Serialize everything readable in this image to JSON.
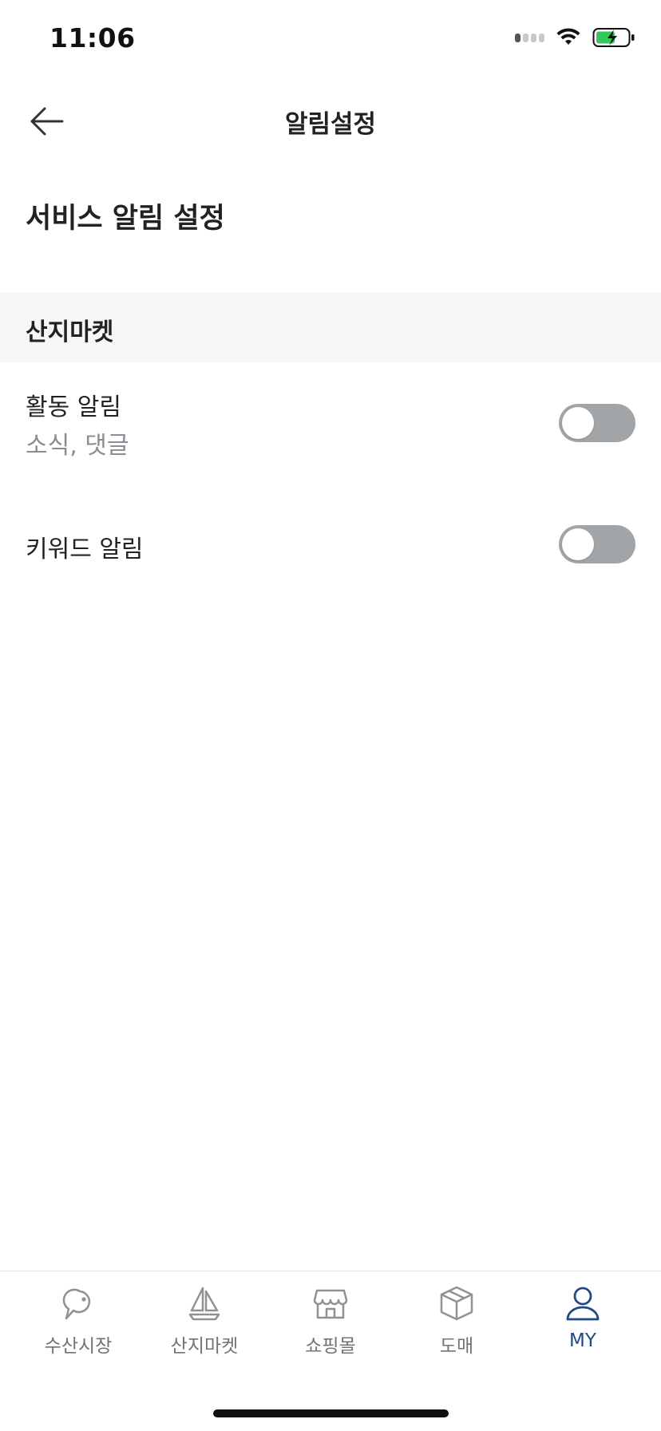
{
  "status": {
    "time": "11:06"
  },
  "header": {
    "title": "알림설정"
  },
  "section": {
    "title": "서비스 알림 설정"
  },
  "group": {
    "title": "산지마켓",
    "items": [
      {
        "label": "활동 알림",
        "sub": "소식, 댓글",
        "enabled": false
      },
      {
        "label": "키워드 알림",
        "enabled": false
      }
    ]
  },
  "tabs": [
    {
      "label": "수산시장",
      "icon": "fish-icon",
      "active": false
    },
    {
      "label": "산지마켓",
      "icon": "sailboat-icon",
      "active": false
    },
    {
      "label": "쇼핑몰",
      "icon": "store-icon",
      "active": false
    },
    {
      "label": "도매",
      "icon": "box-icon",
      "active": false
    },
    {
      "label": "MY",
      "icon": "person-icon",
      "active": true
    }
  ],
  "colors": {
    "accent": "#1e4a8a",
    "toggle_off": "#a2a5a8",
    "group_bg": "#f5f6f8",
    "battery_fill": "#34c759"
  }
}
